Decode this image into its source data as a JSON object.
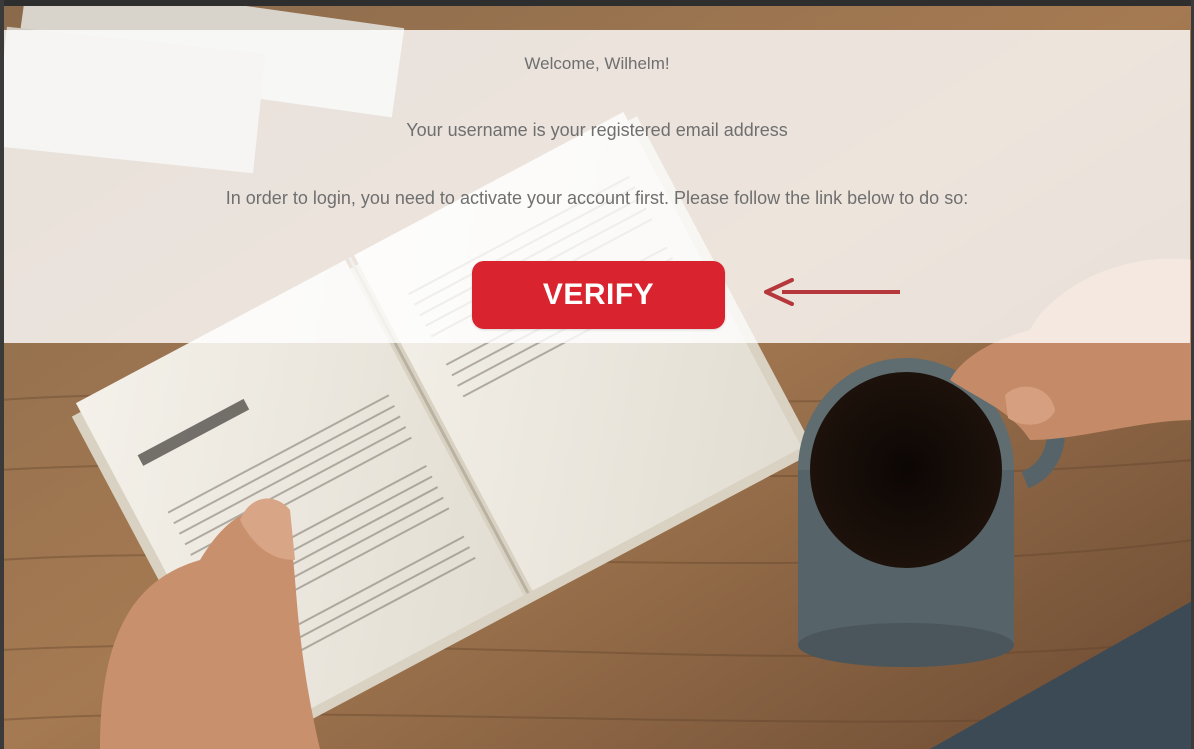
{
  "email": {
    "greeting": "Welcome, Wilhelm!",
    "username_note": "Your username is your registered email address",
    "activation_note": "In order to login, you need to activate your account first. Please follow the link below to do so:",
    "verify_label": "VERIFY"
  },
  "colors": {
    "button": "#d9232e",
    "arrow": "#b5393c",
    "text": "#6f6f6f"
  }
}
